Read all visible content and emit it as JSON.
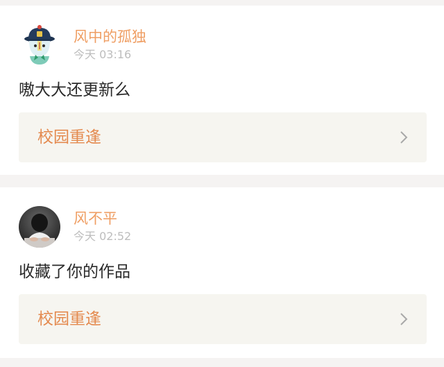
{
  "feed": {
    "items": [
      {
        "username": "风中的孤独",
        "timestamp": "今天 03:16",
        "message": "嗷大大还更新么",
        "topic": "校园重逢",
        "avatar_icon": "cartoon-qing-official-avatar"
      },
      {
        "username": "风不平",
        "timestamp": "今天 02:52",
        "message": "收藏了你的作品",
        "topic": "校园重逢",
        "avatar_icon": "photo-avatar"
      }
    ]
  },
  "colors": {
    "username": "#ef9e63",
    "topic": "#e48a4f",
    "timestamp": "#bdbdbd",
    "message": "#2a2a2a",
    "topic_bg": "#f6f5f0",
    "page_bg": "#f5f3f2"
  }
}
